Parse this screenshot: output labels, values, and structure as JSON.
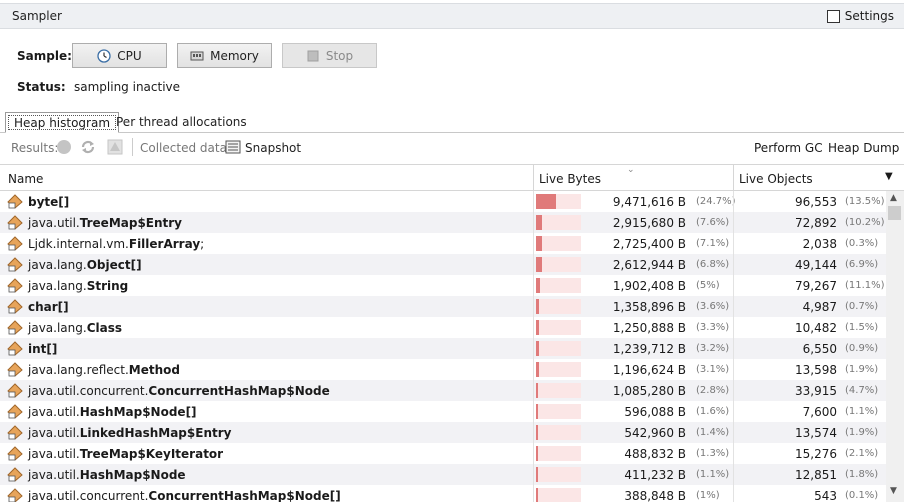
{
  "panel": {
    "title": "Sampler",
    "settings_label": "Settings"
  },
  "controls": {
    "sample_label": "Sample:",
    "cpu_label": "CPU",
    "memory_label": "Memory",
    "stop_label": "Stop",
    "status_label": "Status:",
    "status_value": "sampling inactive"
  },
  "tabs": [
    "Heap histogram",
    "Per thread allocations"
  ],
  "toolbar": {
    "results_label": "Results:",
    "collected_label": "Collected data:",
    "snapshot_label": "Snapshot",
    "perform_gc_label": "Perform GC",
    "heap_dump_label": "Heap Dump"
  },
  "columns": {
    "name": "Name",
    "live_bytes": "Live Bytes",
    "live_objects": "Live Objects"
  },
  "accent": {
    "bar": "#e07a7a",
    "bar_bg": "#fbe6e6",
    "icon": "#e7a45a"
  },
  "rows": [
    {
      "pkg": "",
      "cls": "byte[]",
      "bytes": "9,471,616 B",
      "bytes_pct": "(24.7%)",
      "bytes_fraction": 0.247,
      "objects": "96,553",
      "objects_pct": "(13.5%)"
    },
    {
      "pkg": "java.util.",
      "cls": "TreeMap$Entry",
      "bytes": "2,915,680 B",
      "bytes_pct": "(7.6%)",
      "bytes_fraction": 0.076,
      "objects": "72,892",
      "objects_pct": "(10.2%)"
    },
    {
      "pkg": "Ljdk.internal.vm.",
      "cls": "FillerArray",
      "suffix": ";",
      "bytes": "2,725,400 B",
      "bytes_pct": "(7.1%)",
      "bytes_fraction": 0.071,
      "objects": "2,038",
      "objects_pct": "(0.3%)"
    },
    {
      "pkg": "java.lang.",
      "cls": "Object[]",
      "bytes": "2,612,944 B",
      "bytes_pct": "(6.8%)",
      "bytes_fraction": 0.068,
      "objects": "49,144",
      "objects_pct": "(6.9%)"
    },
    {
      "pkg": "java.lang.",
      "cls": "String",
      "bytes": "1,902,408 B",
      "bytes_pct": "(5%)",
      "bytes_fraction": 0.05,
      "objects": "79,267",
      "objects_pct": "(11.1%)"
    },
    {
      "pkg": "",
      "cls": "char[]",
      "bytes": "1,358,896 B",
      "bytes_pct": "(3.6%)",
      "bytes_fraction": 0.036,
      "objects": "4,987",
      "objects_pct": "(0.7%)"
    },
    {
      "pkg": "java.lang.",
      "cls": "Class",
      "bytes": "1,250,888 B",
      "bytes_pct": "(3.3%)",
      "bytes_fraction": 0.033,
      "objects": "10,482",
      "objects_pct": "(1.5%)"
    },
    {
      "pkg": "",
      "cls": "int[]",
      "bytes": "1,239,712 B",
      "bytes_pct": "(3.2%)",
      "bytes_fraction": 0.032,
      "objects": "6,550",
      "objects_pct": "(0.9%)"
    },
    {
      "pkg": "java.lang.reflect.",
      "cls": "Method",
      "bytes": "1,196,624 B",
      "bytes_pct": "(3.1%)",
      "bytes_fraction": 0.031,
      "objects": "13,598",
      "objects_pct": "(1.9%)"
    },
    {
      "pkg": "java.util.concurrent.",
      "cls": "ConcurrentHashMap$Node",
      "bytes": "1,085,280 B",
      "bytes_pct": "(2.8%)",
      "bytes_fraction": 0.028,
      "objects": "33,915",
      "objects_pct": "(4.7%)"
    },
    {
      "pkg": "java.util.",
      "cls": "HashMap$Node[]",
      "bytes": "596,088 B",
      "bytes_pct": "(1.6%)",
      "bytes_fraction": 0.016,
      "objects": "7,600",
      "objects_pct": "(1.1%)"
    },
    {
      "pkg": "java.util.",
      "cls": "LinkedHashMap$Entry",
      "bytes": "542,960 B",
      "bytes_pct": "(1.4%)",
      "bytes_fraction": 0.014,
      "objects": "13,574",
      "objects_pct": "(1.9%)"
    },
    {
      "pkg": "java.util.",
      "cls": "TreeMap$KeyIterator",
      "bytes": "488,832 B",
      "bytes_pct": "(1.3%)",
      "bytes_fraction": 0.013,
      "objects": "15,276",
      "objects_pct": "(2.1%)"
    },
    {
      "pkg": "java.util.",
      "cls": "HashMap$Node",
      "bytes": "411,232 B",
      "bytes_pct": "(1.1%)",
      "bytes_fraction": 0.011,
      "objects": "12,851",
      "objects_pct": "(1.8%)"
    },
    {
      "pkg": "java.util.concurrent.",
      "cls": "ConcurrentHashMap$Node[]",
      "bytes": "388,848 B",
      "bytes_pct": "(1%)",
      "bytes_fraction": 0.01,
      "objects": "543",
      "objects_pct": "(0.1%)"
    }
  ]
}
